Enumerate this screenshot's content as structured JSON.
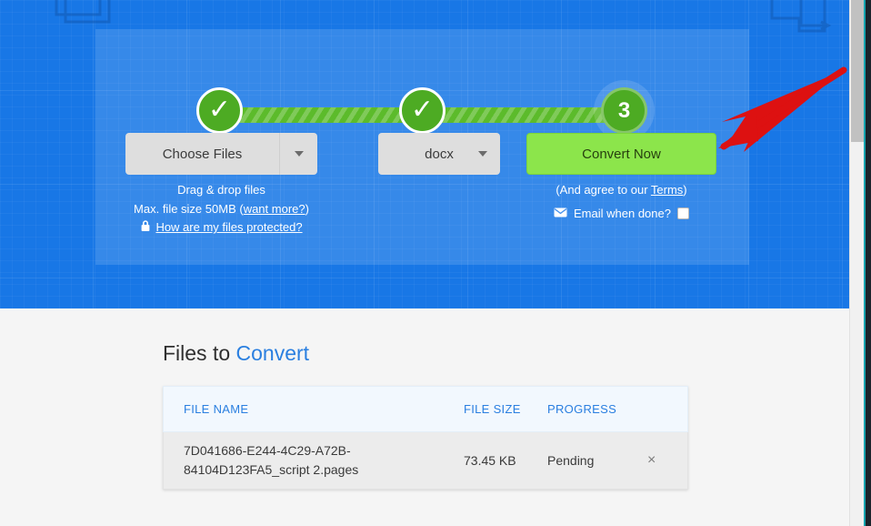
{
  "hero": {
    "decorative_icons": [
      "document-outline-icon",
      "document-outline-icon"
    ],
    "steps": [
      {
        "id": "step-1",
        "state": "complete",
        "glyph": "✓"
      },
      {
        "id": "step-2",
        "state": "complete",
        "glyph": "✓"
      },
      {
        "id": "step-3",
        "state": "current",
        "glyph": "3"
      }
    ],
    "controls": {
      "choose_files_label": "Choose Files",
      "choose_files_caret": "chevron-down-icon",
      "format_value": "docx",
      "format_caret": "chevron-down-icon",
      "convert_label": "Convert Now"
    },
    "left_help": {
      "line1": "Drag & drop files",
      "line2_prefix": "Max. file size 50MB (",
      "line2_link": "want more?",
      "line2_suffix": ")",
      "protected_link": "How are my files protected?",
      "lock_icon": "lock-icon"
    },
    "right_help": {
      "terms_prefix": "(And agree to our ",
      "terms_link": "Terms",
      "terms_suffix": ")",
      "email_icon": "envelope-icon",
      "email_label": "Email when done?",
      "email_checked": false
    }
  },
  "files_section": {
    "heading_plain": "Files to ",
    "heading_accent": "Convert",
    "columns": [
      "FILE NAME",
      "FILE SIZE",
      "PROGRESS"
    ],
    "rows": [
      {
        "name": "7D041686-E244-4C29-A72B-84104D123FA5_script 2.pages",
        "size": "73.45 KB",
        "progress": "Pending",
        "remove": "×"
      }
    ]
  },
  "annotation": {
    "type": "red-arrow",
    "color": "#dd1111",
    "points_to": "convert-now-button"
  },
  "colors": {
    "hero_blue": "#1877e6",
    "accent_blue": "#2a7fe0",
    "step_green": "#4dab23",
    "convert_green": "#8ce54b",
    "annotation_red": "#dd1111"
  },
  "scrollbar": {
    "orientation": "vertical",
    "thumb_position": "top"
  }
}
